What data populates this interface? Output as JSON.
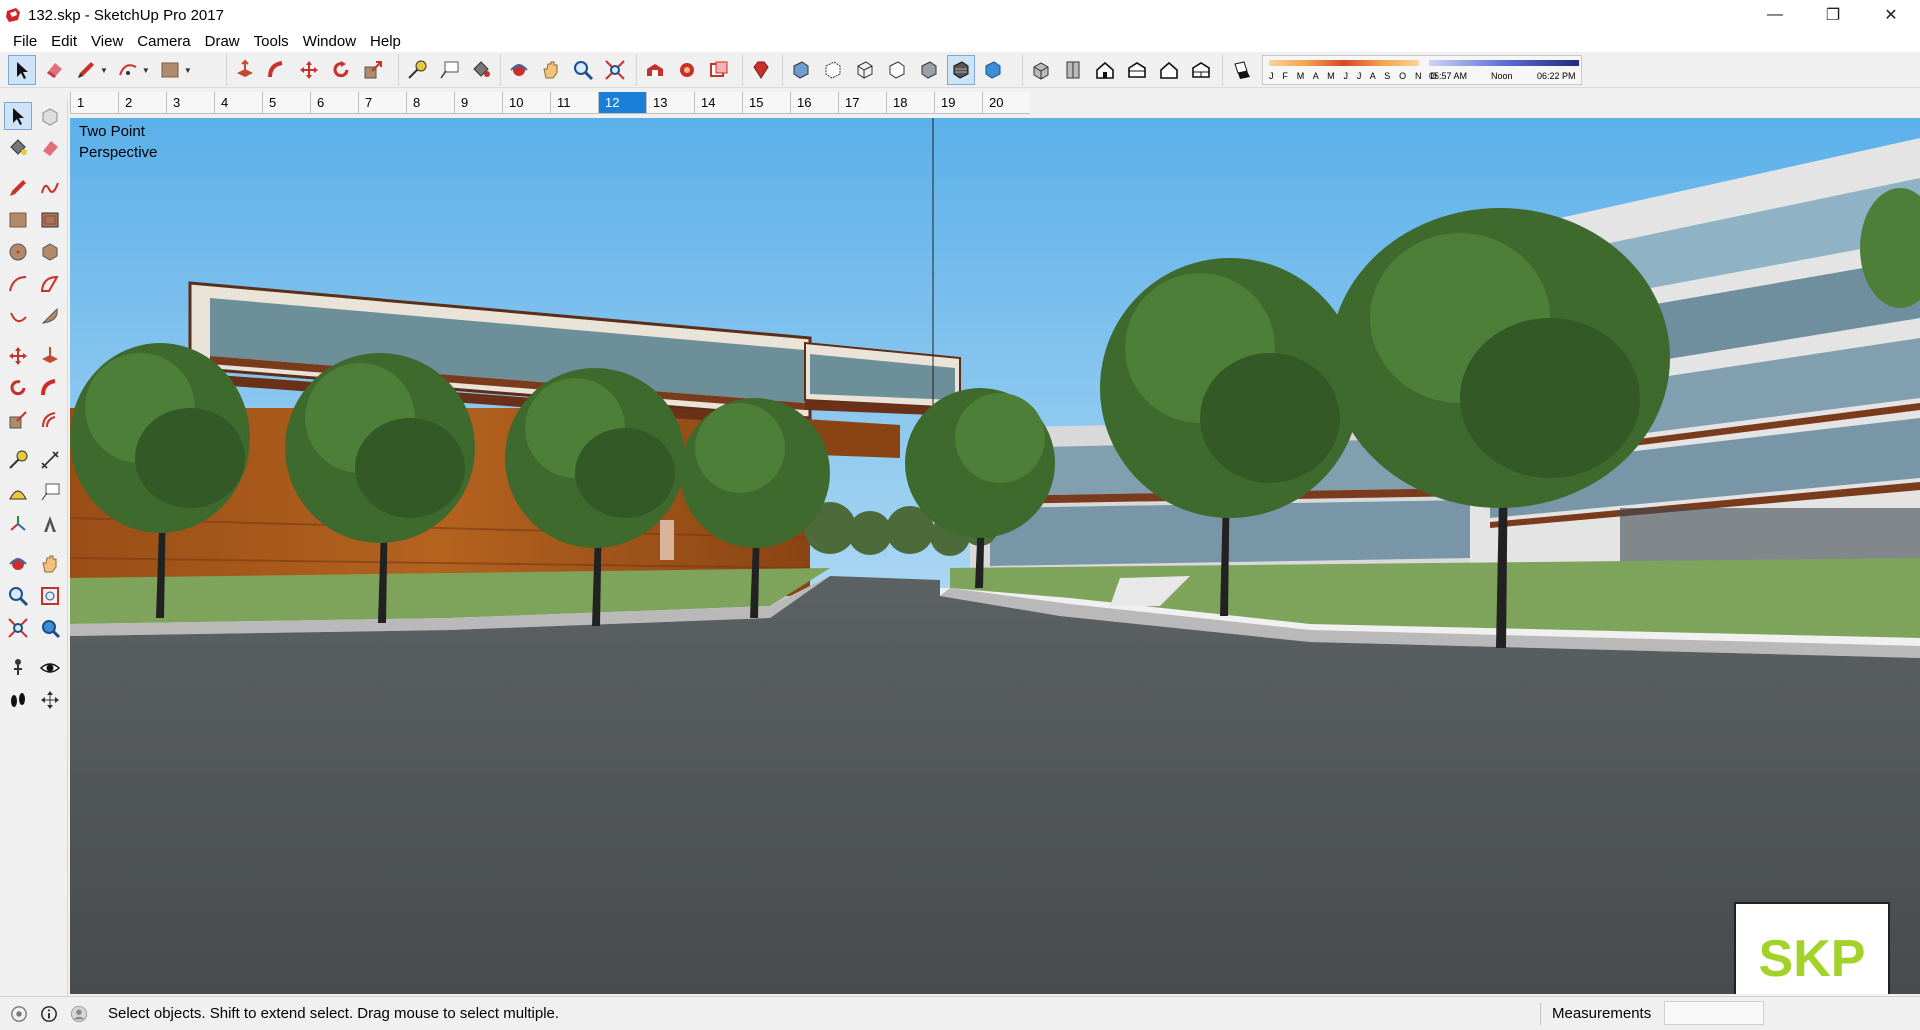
{
  "window": {
    "title": "132.skp - SketchUp Pro 2017",
    "controls": {
      "minimize": "—",
      "restore": "❐",
      "close": "✕"
    }
  },
  "menu": [
    "File",
    "Edit",
    "View",
    "Camera",
    "Draw",
    "Tools",
    "Window",
    "Help"
  ],
  "toolbar": {
    "icons": [
      "select-icon",
      "eraser-icon",
      "pencil-icon",
      "arc-icon",
      "rectangle-icon",
      "push-pull-icon",
      "follow-me-icon",
      "move-icon",
      "rotate-icon",
      "scale-icon",
      "tape-measure-icon",
      "text-icon",
      "paint-bucket-icon",
      "orbit-icon",
      "pan-icon",
      "zoom-icon",
      "zoom-extents-icon",
      "warehouse-icon",
      "extension-warehouse-icon",
      "layout-icon",
      "ruby-icon",
      "xray-icon",
      "back-edges-icon",
      "wireframe-icon",
      "hidden-line-icon",
      "shaded-icon",
      "shaded-textures-icon",
      "monochrome-icon",
      "iso-icon",
      "top-icon",
      "front-icon",
      "right-icon",
      "back-icon",
      "left-icon",
      "shadows-icon"
    ],
    "shadows": {
      "months": "J F M A M J J A S O N D",
      "time_start": "05:57 AM",
      "time_mid": "Noon",
      "time_end": "06:22 PM"
    }
  },
  "scenes": {
    "tabs": [
      "1",
      "2",
      "3",
      "4",
      "5",
      "6",
      "7",
      "8",
      "9",
      "10",
      "11",
      "12",
      "13",
      "14",
      "15",
      "16",
      "17",
      "18",
      "19",
      "20"
    ],
    "active_index": 11
  },
  "viewport": {
    "label_line1": "Two Point",
    "label_line2": "Perspective",
    "logo_text": "SKP",
    "colors": {
      "sky": "#6ab8ec",
      "road": "#4d5153",
      "grass": "#7ea35a",
      "logo_green": "#a3d22a"
    }
  },
  "status": {
    "message": "Select objects. Shift to extend select. Drag mouse to select multiple.",
    "measurements_label": "Measurements",
    "measurements_value": ""
  }
}
